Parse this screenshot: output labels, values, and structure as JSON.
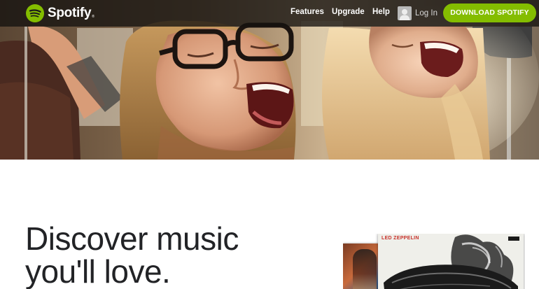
{
  "brand": {
    "name": "Spotify",
    "trademark": "®",
    "accent_color": "#84bd00"
  },
  "nav": {
    "links": [
      {
        "label": "Features"
      },
      {
        "label": "Upgrade"
      },
      {
        "label": "Help"
      }
    ],
    "login_label": "Log In",
    "avatar_icon": "user-silhouette-icon",
    "download_label": "DOWNLOAD SPOTIFY"
  },
  "hero": {
    "image": "photo of two women singing in a car"
  },
  "main": {
    "headline_line1": "Discover music",
    "headline_line2": "you'll love.",
    "album_front_title": "LED ZEPPELIN"
  }
}
